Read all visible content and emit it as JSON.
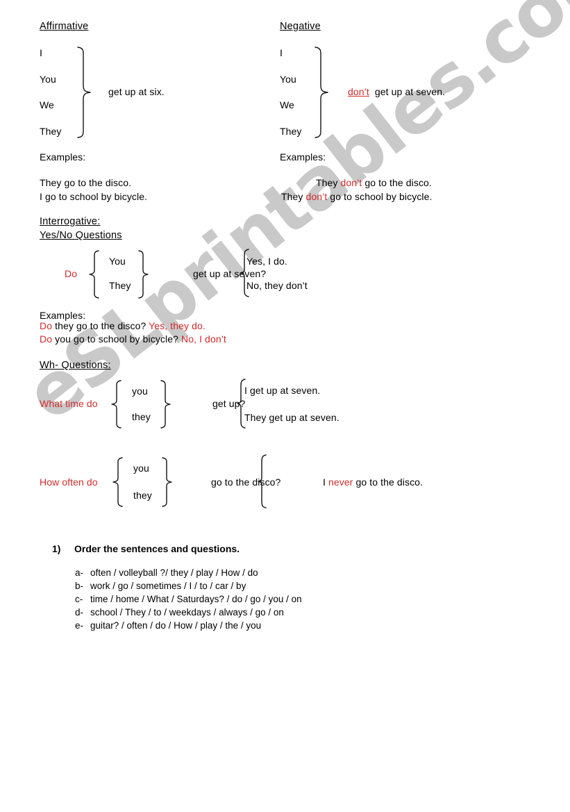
{
  "document": {
    "watermark": "eSLprintables.com",
    "accent_red": "#d02b2b",
    "text_color": "#000000"
  },
  "affirmative": {
    "heading": "Affirmative",
    "subjects": [
      "I",
      "You",
      "We",
      "They"
    ],
    "predicate": "get up at six.",
    "examples_label": "Examples:",
    "examples": [
      "They go to the disco.",
      "I go to school by bicycle."
    ]
  },
  "negative": {
    "heading": "Negative",
    "subjects": [
      "I",
      "You",
      "We",
      "They"
    ],
    "aux": "don’t",
    "predicate": "get up at seven.",
    "examples_label": "Examples:",
    "examples": [
      {
        "pre": "They ",
        "aux": "don’t",
        "post": " go to the disco."
      },
      {
        "pre": "They ",
        "aux": "don’t",
        "post": " go to school by bicycle."
      }
    ]
  },
  "interrogative": {
    "heading": "Interrogative:",
    "subheading": "Yes/No Questions",
    "aux": "Do",
    "subjects": [
      "You",
      "They"
    ],
    "predicate": "get up at seven?",
    "answers": [
      "Yes, I do.",
      "No, they don’t"
    ],
    "examples_label": "Examples:",
    "examples": [
      {
        "aux": "Do",
        "question": " they go to the disco? ",
        "answer": "Yes, they do."
      },
      {
        "aux": "Do",
        "question": " you go to school by bicycle? ",
        "answer": "No, I don’t"
      }
    ]
  },
  "wh_questions": {
    "heading": "Wh- Questions:",
    "blocks": [
      {
        "question_word": "What time do",
        "subjects": [
          "you",
          "they"
        ],
        "predicate": "get up?",
        "answers": [
          "I get up at seven.",
          "They get up at seven."
        ]
      },
      {
        "question_word": "How often do",
        "subjects": [
          "you",
          "they"
        ],
        "predicate": "go to the disco?",
        "answer_pre": "I ",
        "answer_highlight": "never",
        "answer_post": " go to the disco."
      }
    ]
  },
  "exercise": {
    "number": "1)",
    "title": "Order the sentences and questions.",
    "items": [
      {
        "tag": "a-",
        "text": "often / volleyball ?/ they / play / How / do"
      },
      {
        "tag": "b-",
        "text": "work / go / sometimes / I / to / car / by"
      },
      {
        "tag": "c-",
        "text": "time / home / What / Saturdays? / do / go / you / on"
      },
      {
        "tag": "d-",
        "text": "school / They / to / weekdays / always / go / on"
      },
      {
        "tag": "e-",
        "text": "guitar? / often / do / How / play / the / you"
      }
    ]
  }
}
